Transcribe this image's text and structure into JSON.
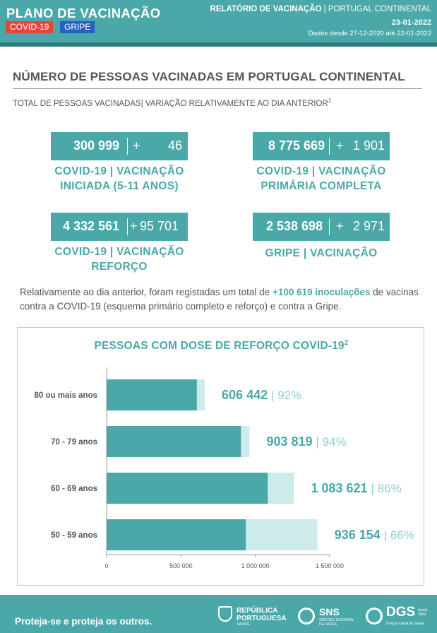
{
  "header": {
    "title": "PLANO DE VACINAÇÃO",
    "tag_covid": "COVID-19",
    "tag_gripe": "GRIPE",
    "report_title": "RELATÓRIO DE VACINAÇÃO",
    "report_sep": " | ",
    "report_region": "PORTUGAL CONTINENTAL",
    "report_date": "23-01-2022",
    "data_range": "Dados desde 27-12-2020 até 22-01-2022",
    "colors": {
      "teal": "#4aa8a8",
      "dark_teal": "#2f7c7c",
      "covid_tag": "#e4463a",
      "gripe_tag": "#2660c0"
    }
  },
  "section": {
    "title": "NÚMERO DE PESSOAS VACINADAS EM PORTUGAL CONTINENTAL",
    "subtitle": "TOTAL DE PESSOAS VACINADAS| VARIAÇÃO RELATIVAMENTE AO DIA ANTERIOR",
    "subtitle_note": "1"
  },
  "stats": [
    {
      "value": "300 999",
      "plus": "+",
      "delta": "46",
      "label_line1": "COVID-19 | VACINAÇÃO",
      "label_line2": "INICIADA (5-11 ANOS)"
    },
    {
      "value": "8 775 669",
      "plus": "+",
      "delta": "1 901",
      "label_line1": "COVID-19 | VACINAÇÃO",
      "label_line2": "PRIMÁRIA COMPLETA"
    },
    {
      "value": "4 332 561",
      "plus": "+",
      "delta": "95 701",
      "label_line1": "COVID-19 | VACINAÇÃO",
      "label_line2": "REFORÇO"
    },
    {
      "value": "2 538 698",
      "plus": "+",
      "delta": "2 971",
      "label_line1": "GRIPE | VACINAÇÃO",
      "label_line2": ""
    }
  ],
  "note": {
    "before": "Relativamente ao dia anterior, foram registadas um total de ",
    "highlight": "+100 619 inoculações",
    "after": " de vacinas contra a COVID-19 (esquema primário completo e reforço) e contra a Gripe."
  },
  "chart_data": {
    "type": "bar",
    "orientation": "horizontal",
    "title": "PESSOAS COM DOSE DE REFORÇO COVID-19",
    "title_note": "2",
    "categories": [
      "80 ou mais anos",
      "70 - 79 anos",
      "60 - 69 anos",
      "50 - 59 anos"
    ],
    "series": [
      {
        "values": [
          606442,
          903819,
          1083621,
          936154
        ],
        "color": "#4aa8a8"
      },
      {
        "values": [
          660000,
          961000,
          1260000,
          1418000
        ],
        "color": "#cdebeb"
      }
    ],
    "value_labels": [
      "606 442",
      "903 819",
      "1 083 621",
      "936 154"
    ],
    "percent_labels": [
      "| 92%",
      "| 94%",
      "| 86%",
      "| 66%"
    ],
    "xlim": [
      0,
      1500000
    ],
    "xticks": [
      0,
      500000,
      1000000,
      1500000
    ],
    "xtick_labels": [
      "0",
      "500 000",
      "1 000 000",
      "1 500 000"
    ],
    "grid": false
  },
  "footer": {
    "slogan": "Proteja-se e proteja os outros.",
    "logo_rp_line1": "REPÚBLICA",
    "logo_rp_line2": "PORTUGUESA",
    "logo_rp_sub": "SAÚDE",
    "logo_sns": "SNS",
    "logo_sns_sub1": "SERVIÇO NACIONAL",
    "logo_sns_sub2": "DE SAÚDE",
    "logo_dgs": "DGS",
    "logo_dgs_year": "desde 1899",
    "logo_dgs_sub": "Direção-Geral da Saúde"
  }
}
